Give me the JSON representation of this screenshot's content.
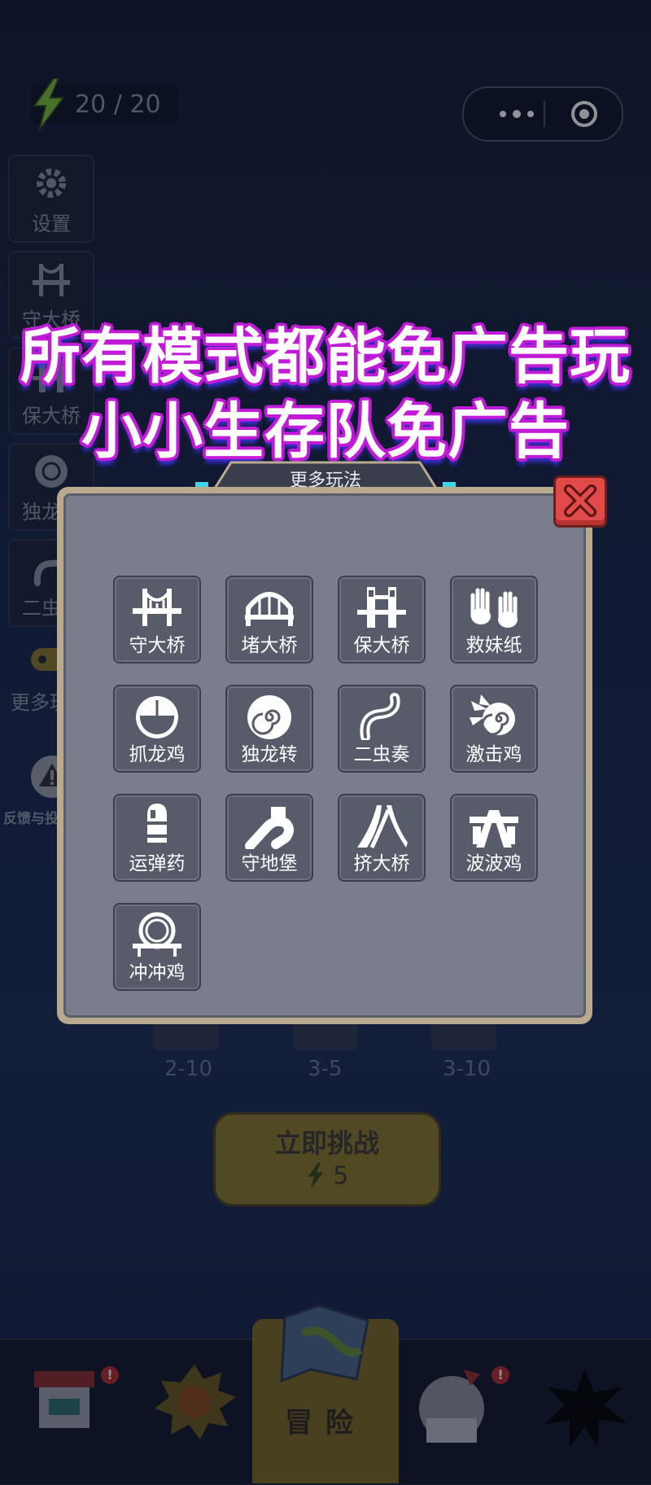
{
  "status": {
    "energy": "20 / 20"
  },
  "side_menu": [
    {
      "label": "设置",
      "icon": "gear-icon"
    },
    {
      "label": "守大桥",
      "icon": "bridge-icon"
    },
    {
      "label": "保大桥",
      "icon": "tower-bridge-icon"
    },
    {
      "label": "独龙转",
      "icon": "spiral-ball-icon"
    },
    {
      "label": "二虫奏",
      "icon": "worm-icon"
    },
    {
      "label": "更多玩法",
      "icon": "gamepad-icon"
    },
    {
      "label": "反馈与投诉",
      "icon": "warning-icon"
    }
  ],
  "promo": {
    "line1": "所有模式都能免广告玩",
    "line2": "小小生存队免广告"
  },
  "modal": {
    "title": "更多玩法",
    "modes": [
      {
        "label": "守大桥",
        "icon": "bridge-icon"
      },
      {
        "label": "堵大桥",
        "icon": "arch-bridge-icon"
      },
      {
        "label": "保大桥",
        "icon": "tower-bridge-icon"
      },
      {
        "label": "救妹纸",
        "icon": "hands-icon"
      },
      {
        "label": "抓龙鸡",
        "icon": "dome-icon"
      },
      {
        "label": "独龙转",
        "icon": "spiral-ball-icon"
      },
      {
        "label": "二虫奏",
        "icon": "worm-icon"
      },
      {
        "label": "激击鸡",
        "icon": "swirl-icon"
      },
      {
        "label": "运弹药",
        "icon": "canister-icon"
      },
      {
        "label": "守地堡",
        "icon": "pipe-icon"
      },
      {
        "label": "挤大桥",
        "icon": "road-icon"
      },
      {
        "label": "波波鸡",
        "icon": "highway-icon"
      },
      {
        "label": "冲冲鸡",
        "icon": "loop-icon"
      }
    ]
  },
  "levels": [
    "2-10",
    "3-5",
    "3-10"
  ],
  "challenge": {
    "label": "立即挑战",
    "cost": "5"
  },
  "bottom_tabs": {
    "center_label": "冒险"
  },
  "colors": {
    "accent_magenta": "#c21bd8",
    "close_red": "#e24a4a",
    "energy_green": "#7cc23a"
  }
}
